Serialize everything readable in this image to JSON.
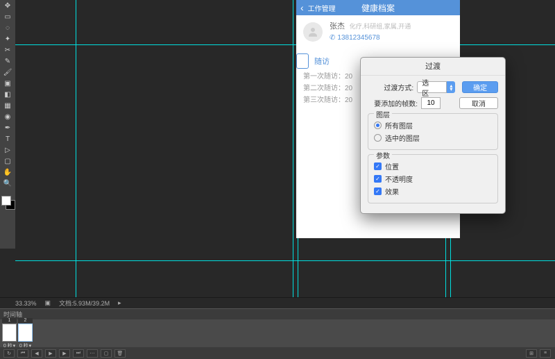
{
  "mockup": {
    "back_label": "工作管理",
    "title": "健康档案",
    "profile": {
      "name": "张杰",
      "tags": "化疗,科研组,家属,开通",
      "phone": "13812345678"
    },
    "section_title": "随访",
    "visits": [
      "第一次随访：20",
      "第二次随访：20",
      "第三次随访：20"
    ]
  },
  "dialog": {
    "title": "过渡",
    "method_label": "过渡方式:",
    "method_value": "选区",
    "frames_label": "要添加的帧数:",
    "frames_value": "10",
    "ok": "确定",
    "cancel": "取消",
    "layers_legend": "图层",
    "layers_all": "所有图层",
    "layers_selected": "选中的图层",
    "params_legend": "参数",
    "param_position": "位置",
    "param_opacity": "不透明度",
    "param_effects": "效果"
  },
  "status": {
    "zoom": "33.33%",
    "doc": "文档:5.93M/39.2M"
  },
  "timeline": {
    "header": "时间轴",
    "frame1_num": "1",
    "frame2_num": "2",
    "frame_time": "0 秒"
  }
}
